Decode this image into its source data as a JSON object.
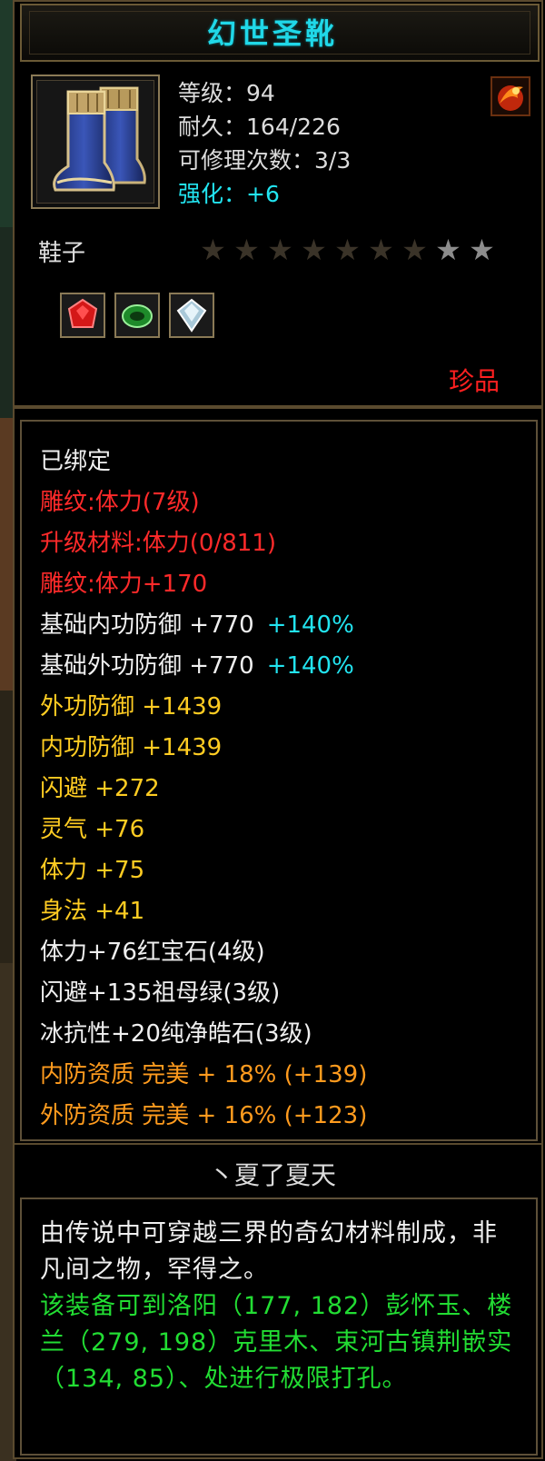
{
  "item": {
    "name": "幻世圣靴",
    "icon": "boots-icon",
    "stats": {
      "level_label": "等级",
      "level_value": "94",
      "durability_label": "耐久",
      "durability_value": "164/226",
      "repair_label": "可修理次数",
      "repair_value": "3/3",
      "enhance_label": "强化",
      "enhance_value": "+6"
    },
    "type": "鞋子",
    "stars": {
      "filled": 7,
      "total": 9
    },
    "sockets": [
      "ruby-gem-icon",
      "emerald-gem-icon",
      "diamond-gem-icon"
    ],
    "rarity": "珍品"
  },
  "attributes": [
    {
      "text": "已绑定",
      "color": "#f0f0f0"
    },
    {
      "text": "雕纹:体力(7级)",
      "color": "#ff2a2a"
    },
    {
      "text": "升级材料:体力(0/811)",
      "color": "#ff2a2a"
    },
    {
      "text": "雕纹:体力+170",
      "color": "#ff2a2a"
    },
    {
      "text": "基础内功防御 +770",
      "extra": "+140%",
      "color": "#f0f0f0"
    },
    {
      "text": "基础外功防御 +770",
      "extra": "+140%",
      "color": "#f0f0f0"
    },
    {
      "text": "外功防御 +1439",
      "color": "#ffcc22"
    },
    {
      "text": "内功防御 +1439",
      "color": "#ffcc22"
    },
    {
      "text": "闪避 +272",
      "color": "#ffcc22"
    },
    {
      "text": "灵气 +76",
      "color": "#ffcc22"
    },
    {
      "text": "体力 +75",
      "color": "#ffcc22"
    },
    {
      "text": "身法 +41",
      "color": "#ffcc22"
    },
    {
      "text": "体力+76红宝石(4级)",
      "color": "#f0f0f0"
    },
    {
      "text": "闪避+135祖母绿(3级)",
      "color": "#f0f0f0"
    },
    {
      "text": "冰抗性+20纯净皓石(3级)",
      "color": "#f0f0f0"
    },
    {
      "text": "内防资质 完美 + 18% (+139)",
      "color": "#ff9b1e"
    },
    {
      "text": "外防资质 完美 + 16% (+123)",
      "color": "#ff9b1e"
    }
  ],
  "owner": "丶夏了夏天",
  "description": {
    "lore": "由传说中可穿越三界的奇幻材料制成，非凡间之物，罕得之。",
    "hint": "该装备可到洛阳（177, 182）彭怀玉、楼兰（279, 198）克里木、束河古镇荆嵌实（134, 85）、处进行极限打孔。"
  }
}
